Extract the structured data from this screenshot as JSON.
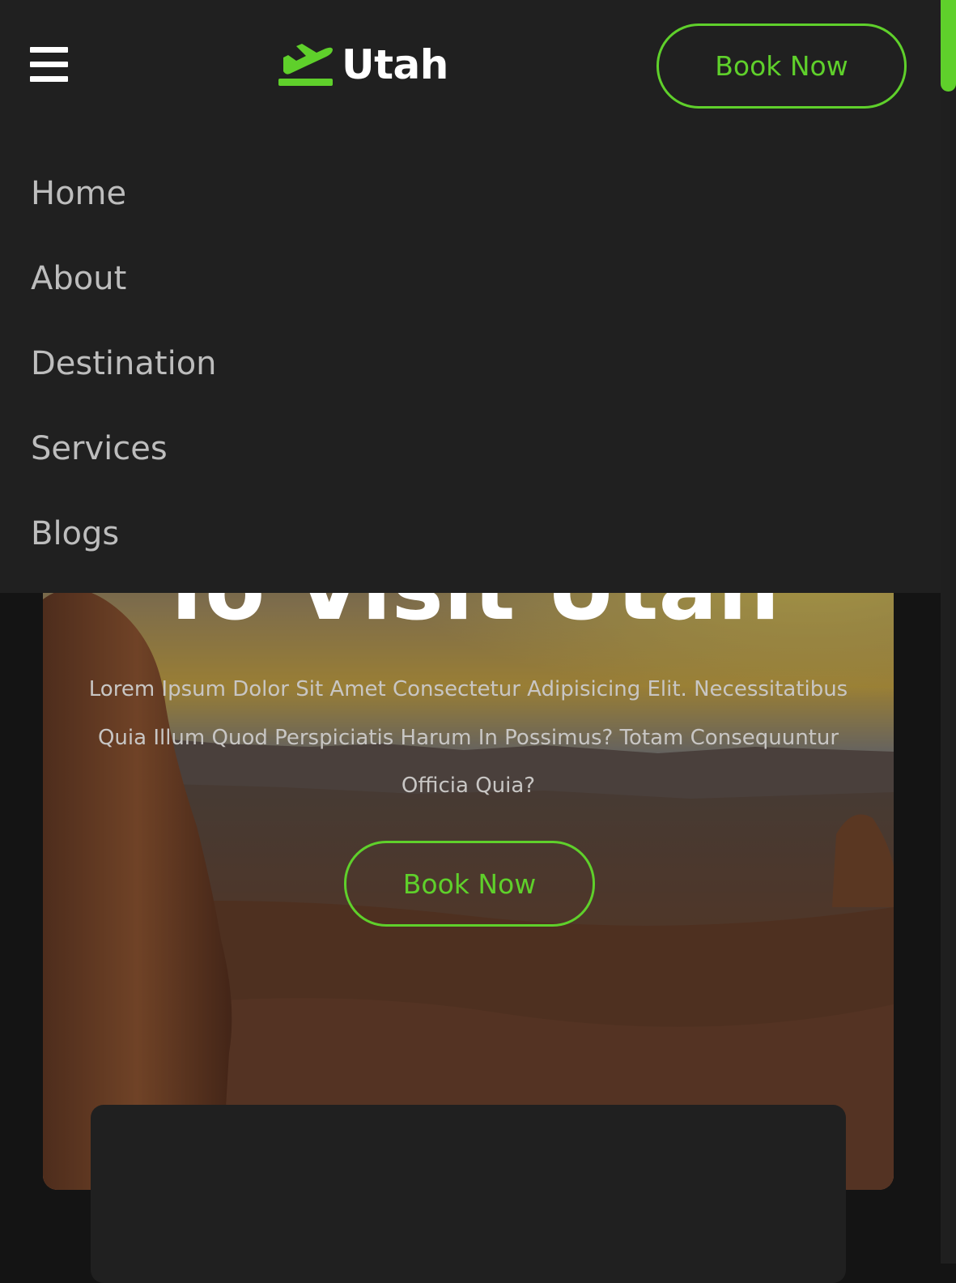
{
  "colors": {
    "accent": "#5fd02b",
    "panel": "#202020",
    "background": "#141414",
    "text_muted": "#bdbdbd"
  },
  "header": {
    "menu_icon": "hamburger-icon",
    "logo_icon": "airplane-takeoff-icon",
    "logo_text": "Utah",
    "book_button": "Book Now"
  },
  "nav": {
    "items": [
      {
        "label": "Home"
      },
      {
        "label": "About"
      },
      {
        "label": "Destination"
      },
      {
        "label": "Services"
      },
      {
        "label": "Blogs"
      }
    ]
  },
  "hero": {
    "title": "To Visit Utah",
    "text": "Lorem Ipsum Dolor Sit Amet Consectetur Adipisicing Elit. Necessitatibus Quia Illum Quod Perspiciatis Harum In Possimus? Totam Consequuntur Officia Quia?",
    "button": "Book Now"
  }
}
